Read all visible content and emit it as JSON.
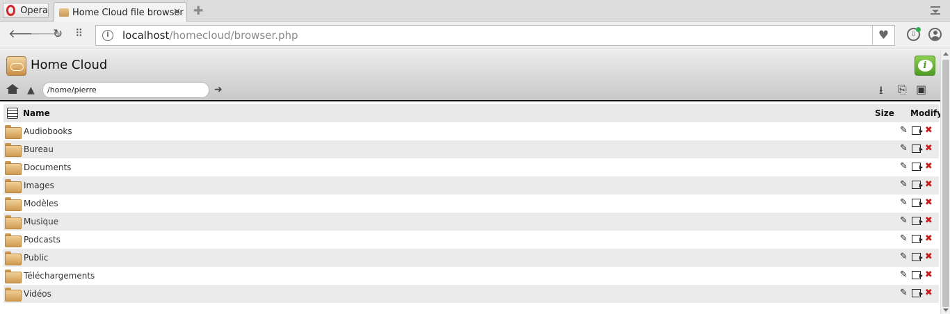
{
  "browser": {
    "opera_label": "Opera",
    "tab_title": "Home Cloud file browser",
    "url_host": "localhost",
    "url_path": "/homecloud/browser.php"
  },
  "app": {
    "title": "Home Cloud",
    "path_value": "/home/pierre"
  },
  "table": {
    "col_name": "Name",
    "col_size": "Size",
    "col_modify": "Modify",
    "rows": [
      {
        "name": "Audiobooks"
      },
      {
        "name": "Bureau"
      },
      {
        "name": "Documents"
      },
      {
        "name": "Images"
      },
      {
        "name": "Modèles"
      },
      {
        "name": "Musique"
      },
      {
        "name": "Podcasts"
      },
      {
        "name": "Public"
      },
      {
        "name": "Téléchargements"
      },
      {
        "name": "Vidéos"
      }
    ]
  },
  "icons": {
    "folder": "folder-icon",
    "rename": "rename-icon",
    "move": "move-icon",
    "delete": "delete-icon"
  },
  "colors": {
    "accent_green": "#5aa62d",
    "delete_red": "#c71e1e",
    "folder_tan": "#d9a862"
  }
}
